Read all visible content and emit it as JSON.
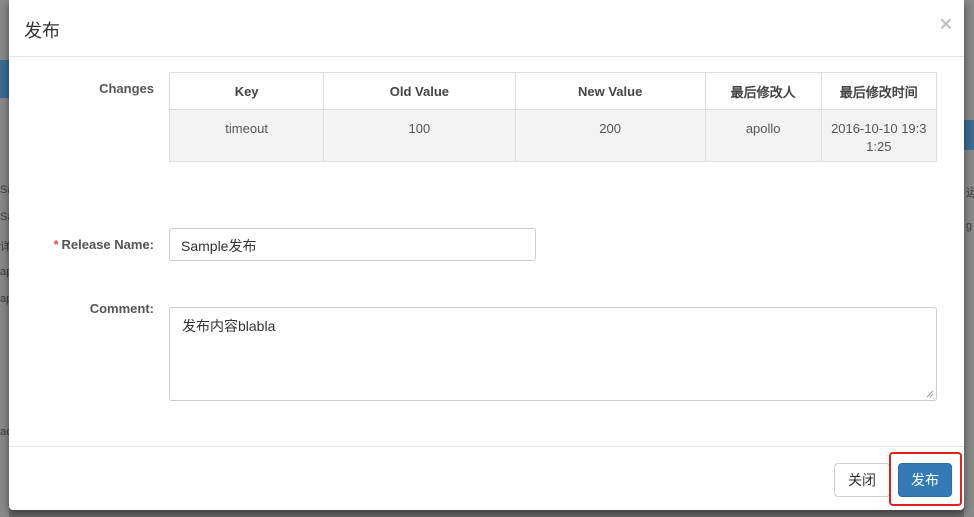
{
  "dialog": {
    "title": "发布",
    "close_glyph": "×"
  },
  "background": {
    "left_fragments": [
      "Sa",
      "Sa",
      "详",
      "ap",
      "ap",
      "ac"
    ],
    "right_fragments": [
      "运",
      "g"
    ]
  },
  "form": {
    "changes_label": "Changes",
    "release_name_required_mark": "*",
    "release_name_label": "Release Name:",
    "release_name_value": "Sample发布",
    "comment_label": "Comment:",
    "comment_value": "发布内容blabla"
  },
  "changes_table": {
    "headers": [
      "Key",
      "Old Value",
      "New Value",
      "最后修改人",
      "最后修改时间"
    ],
    "rows": [
      [
        "timeout",
        "100",
        "200",
        "apollo",
        "2016-10-10 19:31:25"
      ]
    ]
  },
  "footer": {
    "close_label": "关闭",
    "publish_label": "发布"
  },
  "colors": {
    "primary": "#337ab7",
    "highlight": "#e02020",
    "required": "#d9534f"
  }
}
